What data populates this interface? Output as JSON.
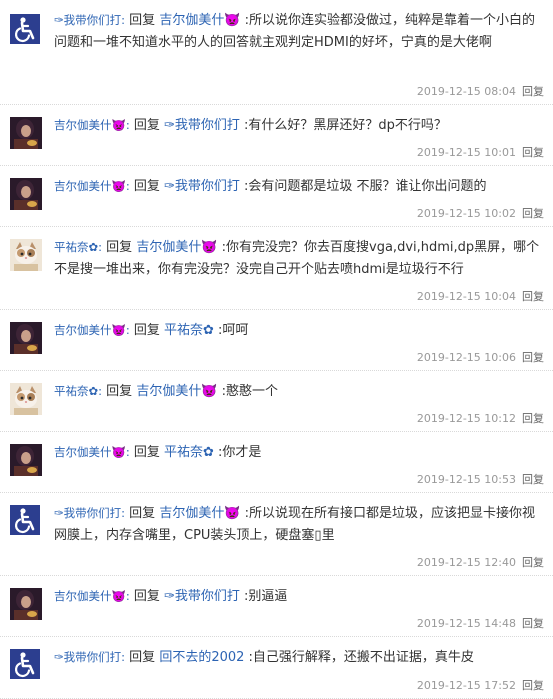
{
  "icons": {
    "wheelchair": "wheelchair-avatar-icon",
    "reply": "reply-link"
  },
  "colors": {
    "username": "#2d64b3",
    "meta": "#999999",
    "divider": "#d9d9d9"
  },
  "replies": [
    {
      "user": "✑我带你们打:",
      "reply_word": "回复",
      "target": "吉尔伽美什👿",
      "text": ":所以说你连实验都没做过，纯粹是靠着一个小白的问题和一堆不知道水平的人的回答就主观判定HDMI的好坏，宁真的是大佬啊",
      "time": "2019-12-15 08:04",
      "reply_label": "回复",
      "avatar": "wheelchair"
    },
    {
      "user": "吉尔伽美什👿:",
      "reply_word": "回复",
      "target": "✑我带你们打",
      "text": ":有什么好？黑屏还好？dp不行吗？",
      "time": "2019-12-15 10:01",
      "reply_label": "回复",
      "avatar": "dark"
    },
    {
      "user": "吉尔伽美什👿:",
      "reply_word": "回复",
      "target": "✑我带你们打",
      "text": ":会有问题都是垃圾 不服？谁让你出问题的",
      "time": "2019-12-15 10:02",
      "reply_label": "回复",
      "avatar": "dark"
    },
    {
      "user": "平祐奈✿:",
      "reply_word": "回复",
      "target": "吉尔伽美什👿",
      "text": ":你有完没完？你去百度搜vga,dvi,hdmi,dp黑屏，哪个不是搜一堆出来，你有完没完？没完自己开个贴去喷hdmi是垃圾行不行",
      "time": "2019-12-15 10:04",
      "reply_label": "回复",
      "avatar": "cat"
    },
    {
      "user": "吉尔伽美什👿:",
      "reply_word": "回复",
      "target": "平祐奈✿",
      "text": ":呵呵",
      "time": "2019-12-15 10:06",
      "reply_label": "回复",
      "avatar": "dark"
    },
    {
      "user": "平祐奈✿:",
      "reply_word": "回复",
      "target": "吉尔伽美什👿",
      "text": ":憨憨一个",
      "time": "2019-12-15 10:12",
      "reply_label": "回复",
      "avatar": "cat"
    },
    {
      "user": "吉尔伽美什👿:",
      "reply_word": "回复",
      "target": "平祐奈✿",
      "text": ":你才是",
      "time": "2019-12-15 10:53",
      "reply_label": "回复",
      "avatar": "dark"
    },
    {
      "user": "✑我带你们打:",
      "reply_word": "回复",
      "target": "吉尔伽美什👿",
      "text": ":所以说现在所有接口都是垃圾，应该把显卡接你视网膜上，内存含嘴里，CPU装头顶上，硬盘塞▯里",
      "time": "2019-12-15 12:40",
      "reply_label": "回复",
      "avatar": "wheelchair"
    },
    {
      "user": "吉尔伽美什👿:",
      "reply_word": "回复",
      "target": "✑我带你们打",
      "text": ":别逼逼",
      "time": "2019-12-15 14:48",
      "reply_label": "回复",
      "avatar": "dark"
    },
    {
      "user": "✑我带你们打:",
      "reply_word": "回复",
      "target": "回不去的2002",
      "text": ":自己强行解释，还搬不出证据，真牛皮",
      "time": "2019-12-15 17:52",
      "reply_label": "回复",
      "avatar": "wheelchair"
    }
  ]
}
